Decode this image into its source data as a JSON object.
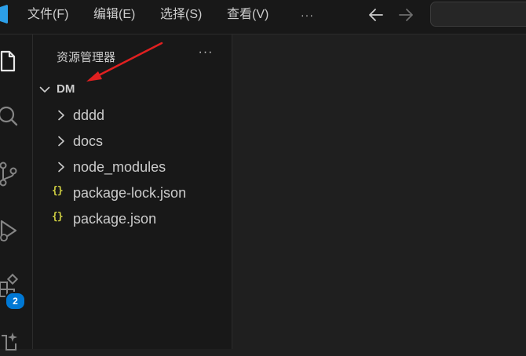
{
  "menu": {
    "items": [
      {
        "label": "文件(F)"
      },
      {
        "label": "编辑(E)"
      },
      {
        "label": "选择(S)"
      },
      {
        "label": "查看(V)"
      },
      {
        "label": "···"
      }
    ]
  },
  "nav": {
    "back_icon": "arrow-left-icon",
    "forward_icon": "arrow-right-icon"
  },
  "activity_bar": {
    "icons": [
      "explorer-icon",
      "search-icon",
      "source-control-icon",
      "run-debug-icon",
      "extensions-icon",
      "copilot-icon"
    ],
    "extensions_badge": "2"
  },
  "explorer": {
    "title": "资源管理器",
    "more_label": "···",
    "root": {
      "label": "DM",
      "expanded": true
    },
    "items": [
      {
        "label": "dddd",
        "type": "folder",
        "expanded": false
      },
      {
        "label": "docs",
        "type": "folder",
        "expanded": false
      },
      {
        "label": "node_modules",
        "type": "folder",
        "expanded": false
      },
      {
        "label": "package-lock.json",
        "type": "json",
        "icon_text": "{}"
      },
      {
        "label": "package.json",
        "type": "json",
        "icon_text": "{}"
      }
    ]
  },
  "colors": {
    "background": "#1f1f1f",
    "panel": "#181818",
    "accent": "#0078d4",
    "json_icon": "#cbcb41",
    "annotation_arrow": "#e02020"
  }
}
